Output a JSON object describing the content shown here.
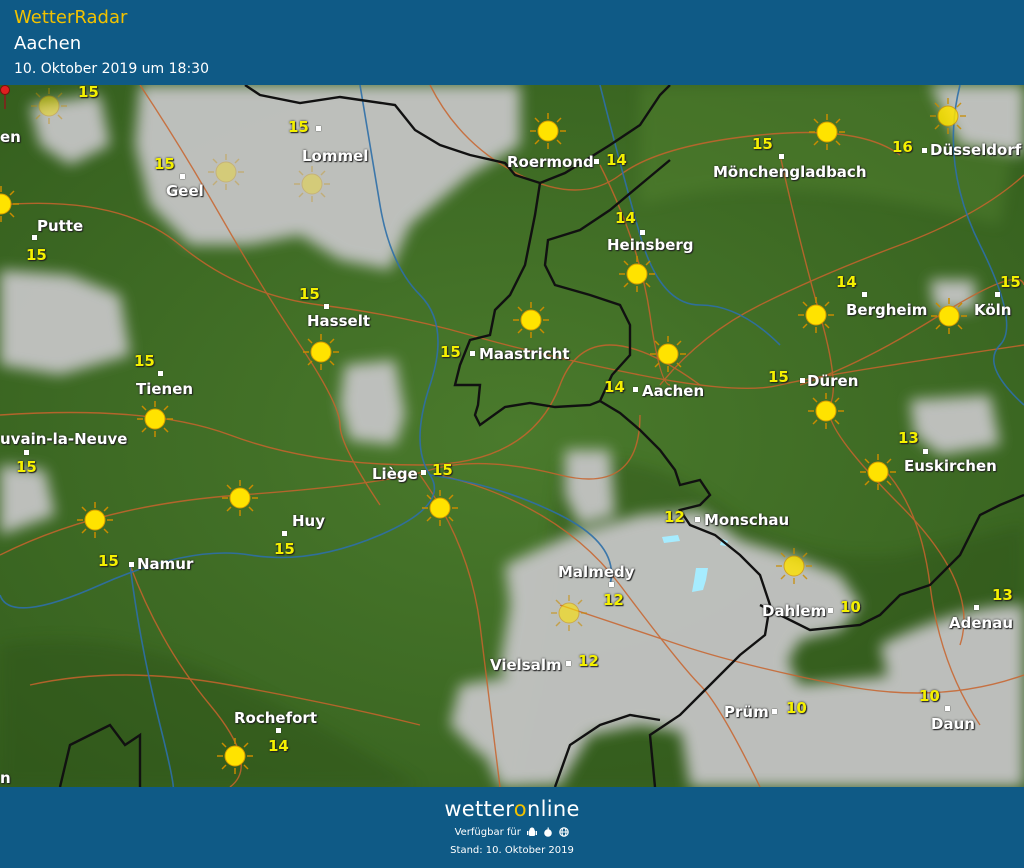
{
  "header": {
    "brand": "WetterRadar",
    "place": "Aachen",
    "datetime": "10. Oktober 2019 um 18:30"
  },
  "footer": {
    "logo_part1": "wetter",
    "logo_o": "o",
    "logo_part2": "nline",
    "available": "Verfügbar für",
    "platform_icons": [
      "android-icon",
      "apple-icon",
      "web-icon"
    ],
    "stand": "Stand: 10. Oktober 2019"
  },
  "colors": {
    "header_bg": "#0f5a86",
    "brand": "#f2c200",
    "land": "#3d6b22",
    "cloud": "#bfbfbf",
    "rain": "#9fe8ff",
    "temperature": "#f4f000",
    "roads": "#c8642d",
    "rivers": "#2e6fa8",
    "borders": "#111111"
  },
  "map": {
    "cities": [
      {
        "name": "Lommel",
        "temp": ""
      },
      {
        "name": "Roermond",
        "temp": "14"
      },
      {
        "name": "Mönchengladbach",
        "temp": "15"
      },
      {
        "name": "Düsseldorf",
        "temp": "16"
      },
      {
        "name": "Geel",
        "temp": "15"
      },
      {
        "name": "Putte",
        "temp": "15"
      },
      {
        "name": "Heinsberg",
        "temp": "14"
      },
      {
        "name": "Hasselt",
        "temp": "15"
      },
      {
        "name": "Bergheim",
        "temp": "14"
      },
      {
        "name": "Köln",
        "temp": "15"
      },
      {
        "name": "Maastricht",
        "temp": "15"
      },
      {
        "name": "Tienen",
        "temp": "15"
      },
      {
        "name": "Aachen",
        "temp": "14"
      },
      {
        "name": "Düren",
        "temp": "15"
      },
      {
        "name": "uvain-la-Neuve",
        "temp": "15"
      },
      {
        "name": "Euskirchen",
        "temp": "13"
      },
      {
        "name": "Liège",
        "temp": "15"
      },
      {
        "name": "Huy",
        "temp": "15"
      },
      {
        "name": "Monschau",
        "temp": "12"
      },
      {
        "name": "Namur",
        "temp": "15"
      },
      {
        "name": "Malmedy",
        "temp": "12"
      },
      {
        "name": "Dahlem",
        "temp": "10"
      },
      {
        "name": "Adenau",
        "temp": "13"
      },
      {
        "name": "Vielsalm",
        "temp": "12"
      },
      {
        "name": "Prüm",
        "temp": "10"
      },
      {
        "name": "Daun",
        "temp": "10"
      },
      {
        "name": "Rochefort",
        "temp": "14"
      }
    ],
    "extra_temps": [
      "15",
      "15"
    ],
    "edge_labels": [
      "en",
      "n"
    ],
    "selected_location": "Aachen"
  }
}
